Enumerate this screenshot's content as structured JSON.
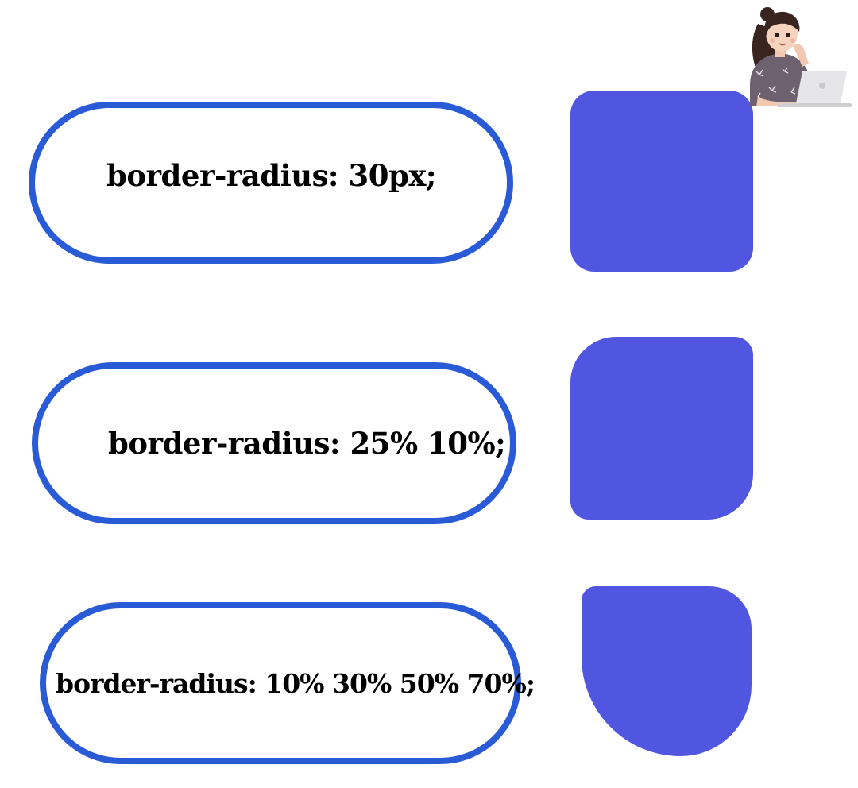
{
  "examples": [
    {
      "label": "border-radius: 30px;"
    },
    {
      "label": "border-radius: 25% 10%;"
    },
    {
      "label": "border-radius: 10% 30% 50% 70%;"
    }
  ],
  "colors": {
    "pill_border": "#2a5bd7",
    "shape_fill": "#5056df",
    "background": "#ffffff"
  },
  "avatar": {
    "icon": "girl-with-laptop-illustration"
  }
}
